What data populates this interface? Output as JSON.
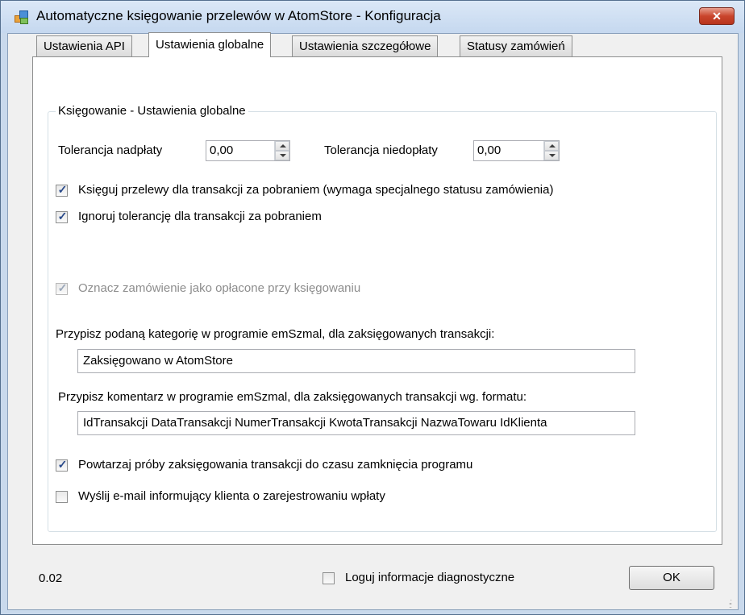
{
  "window": {
    "title": "Automatyczne księgowanie przelewów w AtomStore - Konfiguracja",
    "close_label": "✕"
  },
  "tabs": [
    {
      "label": "Ustawienia API",
      "active": false
    },
    {
      "label": "Ustawienia globalne",
      "active": true
    },
    {
      "label": "Ustawienia szczegółowe",
      "active": false
    },
    {
      "label": "Statusy zamówień",
      "active": false
    }
  ],
  "group": {
    "legend": "Księgowanie - Ustawienia globalne",
    "overpay_label": "Tolerancja nadpłaty",
    "overpay_value": "0,00",
    "underpay_label": "Tolerancja niedopłaty",
    "underpay_value": "0,00",
    "cb_cod_label": "Księguj przelewy dla transakcji za pobraniem (wymaga specjalnego statusu zamówienia)",
    "cb_cod_checked": true,
    "cb_ignore_label": "Ignoruj tolerancję dla transakcji za pobraniem",
    "cb_ignore_checked": true,
    "cb_paid_label": "Oznacz zamówienie jako opłacone przy księgowaniu",
    "cb_paid_checked": true,
    "category_label": "Przypisz podaną kategorię w programie emSzmal, dla zaksięgowanych transakcji:",
    "category_value": "Zaksięgowano w AtomStore",
    "comment_label": "Przypisz komentarz w programie emSzmal, dla zaksięgowanych transakcji wg. formatu:",
    "comment_value": "IdTransakcji DataTransakcji NumerTransakcji KwotaTransakcji NazwaTowaru IdKlienta",
    "cb_retry_label": "Powtarzaj próby zaksięgowania transakcji do czasu zamknięcia programu",
    "cb_retry_checked": true,
    "cb_email_label": "Wyślij e-mail informujący klienta o zarejestrowaniu wpłaty",
    "cb_email_checked": false
  },
  "footer": {
    "version": "0.02",
    "cb_log_label": "Loguj informacje diagnostyczne",
    "cb_log_checked": false,
    "ok_label": "OK"
  },
  "colors": {
    "title_bar": "#c5d8ef",
    "close_button": "#c9452c",
    "checkmark": "#2a4a8a"
  }
}
